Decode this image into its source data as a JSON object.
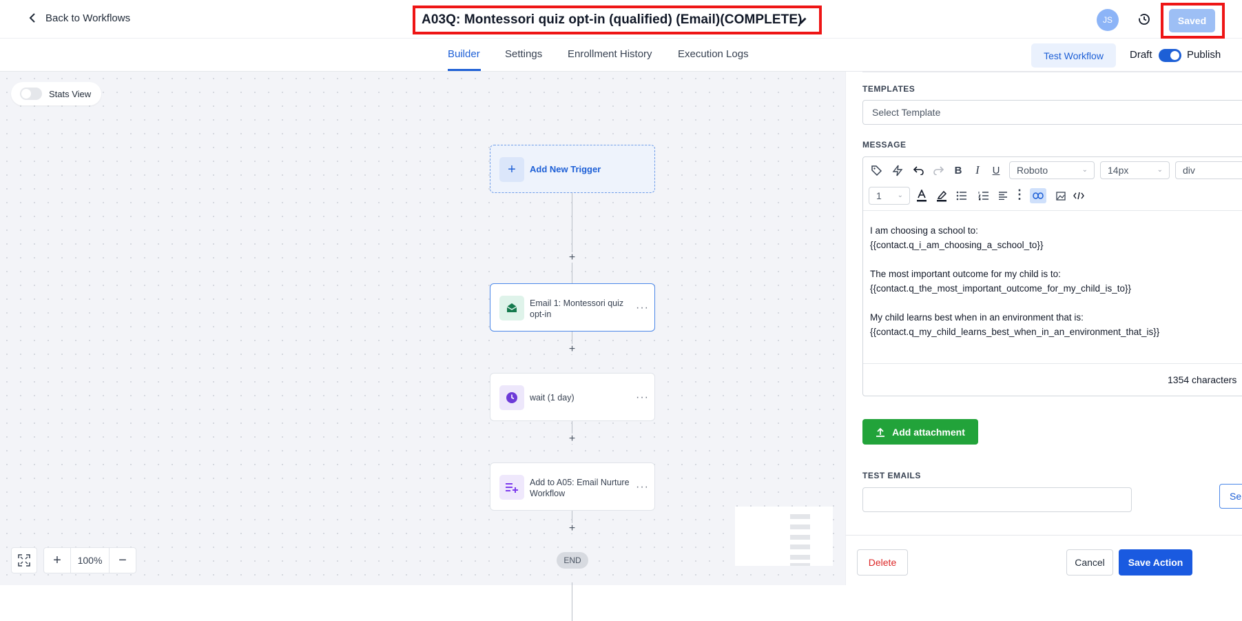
{
  "header": {
    "back_label": "Back to Workflows",
    "title": "A03Q: Montessori quiz opt-in (qualified) (Email)(COMPLETE)",
    "avatar_initials": "JS",
    "saved_label": "Saved"
  },
  "tabs": {
    "items": [
      "Builder",
      "Settings",
      "Enrollment History",
      "Execution Logs"
    ],
    "active": "Builder",
    "test_workflow": "Test Workflow",
    "draft_label": "Draft",
    "publish_label": "Publish",
    "publish_on": true
  },
  "canvas": {
    "stats_label": "Stats View",
    "trigger_label": "Add New Trigger",
    "nodes": [
      {
        "label": "Email 1: Montessori quiz opt-in",
        "icon": "email-icon",
        "selected": true
      },
      {
        "label": "wait (1 day)",
        "icon": "clock-icon",
        "selected": false
      },
      {
        "label": "Add to A05: Email Nurture Workflow",
        "icon": "add-to-list-icon",
        "selected": false
      }
    ],
    "end_label": "END",
    "zoom_level": "100%"
  },
  "panel": {
    "templates_label": "TEMPLATES",
    "template_placeholder": "Select Template",
    "message_label": "MESSAGE",
    "toolbar": {
      "font": "Roboto",
      "size": "14px",
      "block": "div",
      "line_height": "1"
    },
    "message_lines": [
      "I am choosing a school to:",
      "{{contact.q_i_am_choosing_a_school_to}}",
      "",
      "The most important outcome for my child is to:",
      "{{contact.q_the_most_important_outcome_for_my_child_is_to}}",
      "",
      "My child learns best when in an environment that is:",
      "{{contact.q_my_child_learns_best_when_in_an_environment_that_is}}"
    ],
    "char_count": "1354 characters",
    "attach_label": "Add attachment",
    "test_emails_label": "TEST EMAILS",
    "send_label": "Se",
    "delete_label": "Delete",
    "cancel_label": "Cancel",
    "save_label": "Save Action"
  },
  "colors": {
    "accent": "#1d5fd6",
    "highlight_border": "#ee1515",
    "attach_green": "#22a33a",
    "delete_red": "#dc2626"
  }
}
